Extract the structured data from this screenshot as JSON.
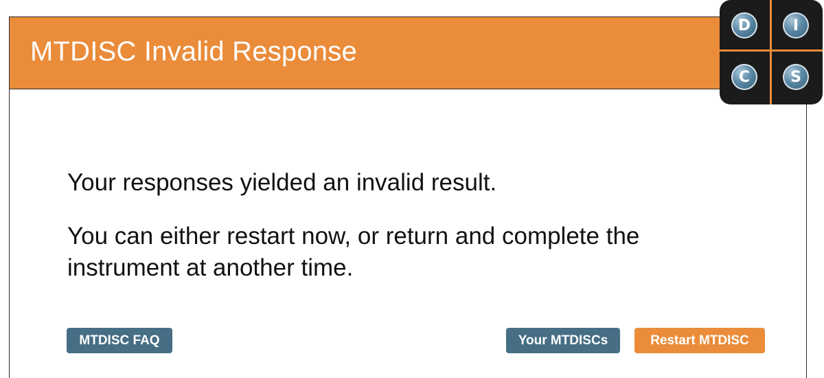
{
  "header": {
    "title": "MTDISC Invalid Response"
  },
  "message": {
    "line1": "Your responses yielded an invalid result.",
    "line2": "You can either restart now, or return and complete the instrument at another time."
  },
  "buttons": {
    "faq_label": "MTDISC FAQ",
    "your_label": "Your MTDISCs",
    "restart_label": "Restart MTDISC"
  },
  "logo": {
    "letters": [
      "D",
      "I",
      "C",
      "S"
    ]
  },
  "colors": {
    "accent_orange": "#ea8c3a",
    "button_blue": "#466e85",
    "logo_bg": "#1b1b1b"
  }
}
